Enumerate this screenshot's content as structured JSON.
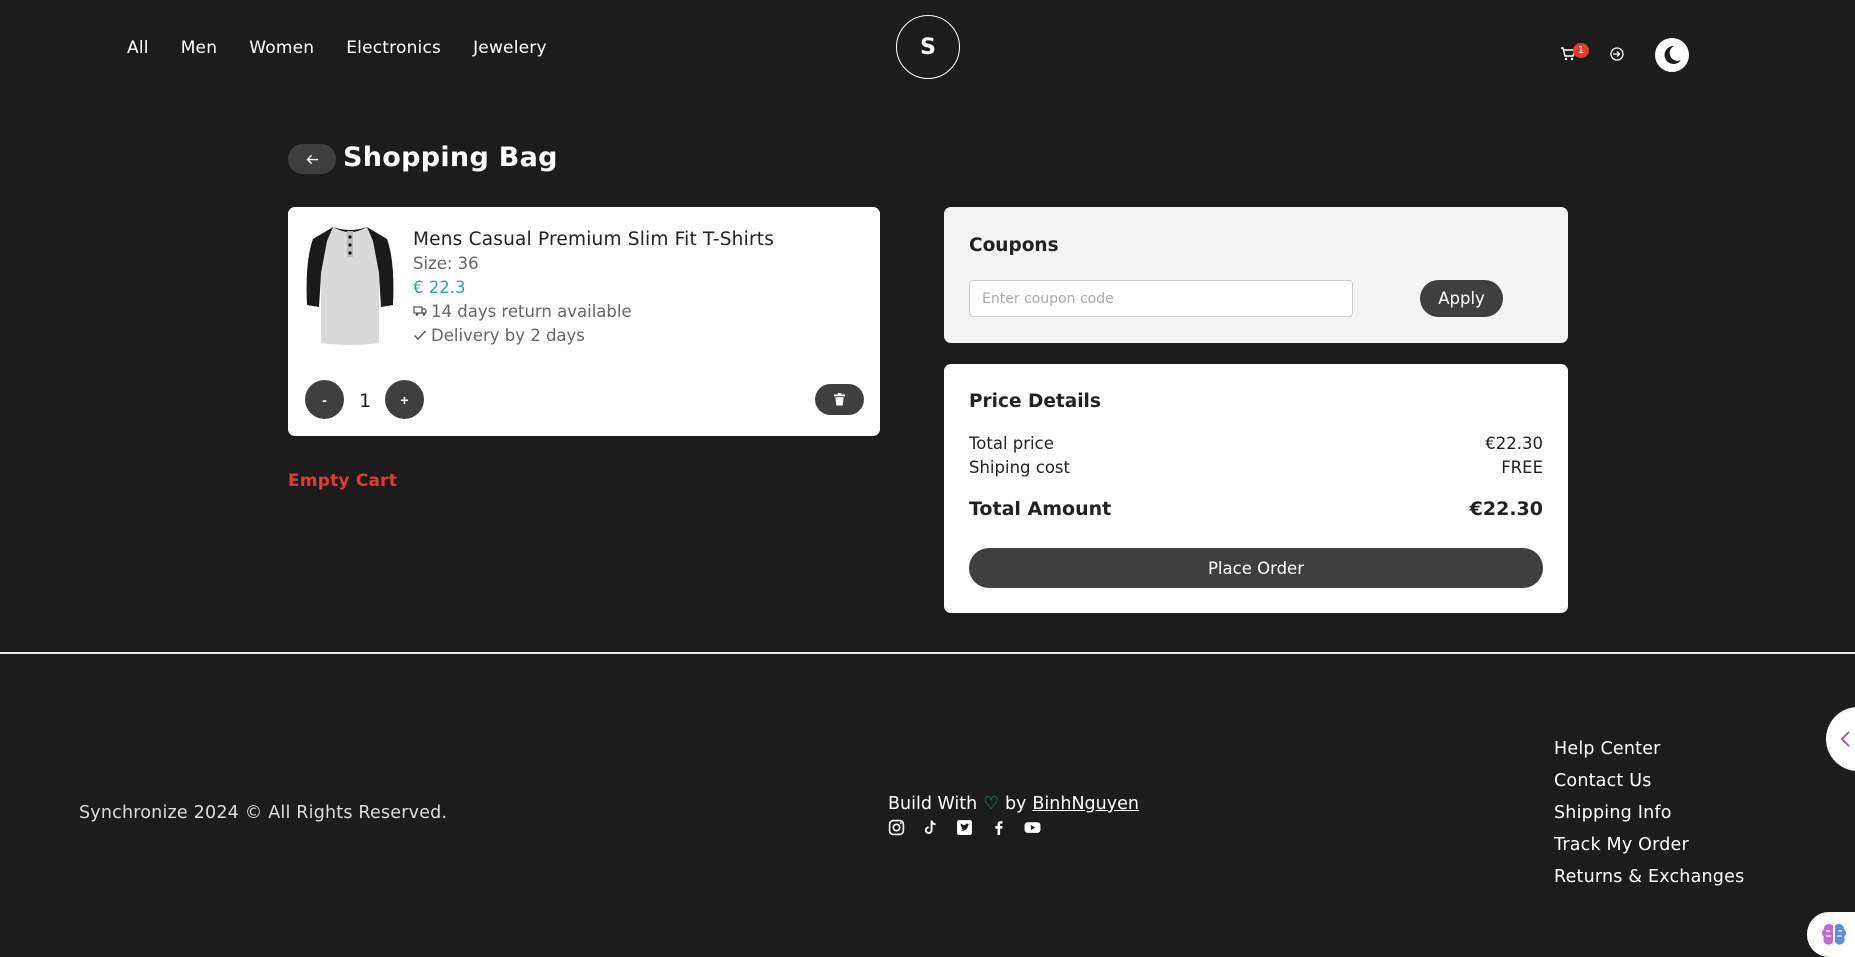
{
  "header": {
    "nav": [
      "All",
      "Men",
      "Women",
      "Electronics",
      "Jewelery"
    ],
    "logo_letter": "S",
    "cart_count": "1"
  },
  "page": {
    "title": "Shopping Bag"
  },
  "cart_item": {
    "name": "Mens Casual Premium Slim Fit T-Shirts",
    "size": "Size: 36",
    "price": "€ 22.3",
    "return_text": "14 days return available",
    "delivery_text": "Delivery by 2 days",
    "qty_minus": "-",
    "qty_plus": "+",
    "quantity": "1"
  },
  "empty_cart_label": "Empty Cart",
  "coupons": {
    "title": "Coupons",
    "placeholder": "Enter coupon code",
    "apply_label": "Apply"
  },
  "price_details": {
    "title": "Price Details",
    "total_price_label": "Total price",
    "total_price_value": "€22.30",
    "shipping_label": "Shiping cost",
    "shipping_value": "FREE",
    "total_amount_label": "Total Amount",
    "total_amount_value": "€22.30",
    "place_order_label": "Place Order"
  },
  "footer": {
    "copyright": "Synchronize 2024 © All Rights Reserved.",
    "build_prefix": "Build With",
    "heart": "♡",
    "build_by": "by",
    "author": "BinhNguyen",
    "links": [
      "Help Center",
      "Contact Us",
      "Shipping Info",
      "Track My Order",
      "Returns & Exchanges"
    ],
    "socials": [
      "instagram-icon",
      "tiktok-icon",
      "twitter-icon",
      "facebook-icon",
      "youtube-icon"
    ]
  },
  "colors": {
    "background": "#1c1c1c",
    "accent_teal": "#2aa79a",
    "danger_red": "#e33b2e",
    "button_dark": "#3f3f3f"
  }
}
